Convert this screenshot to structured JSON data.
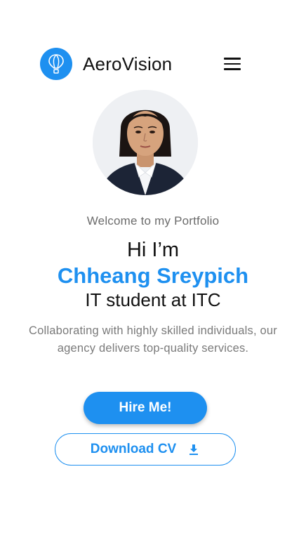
{
  "header": {
    "brand": "AeroVision",
    "logo_icon": "hot-air-balloon-icon",
    "menu_icon": "hamburger-menu-icon",
    "accent_color": "#1e90f0"
  },
  "hero": {
    "welcome": "Welcome to my Portfolio",
    "greeting": "Hi I’m",
    "name": "Chheang Sreypich",
    "role": "IT student at ITC",
    "description": "Collaborating with highly skilled individuals, our agency delivers top-quality services."
  },
  "actions": {
    "hire_label": "Hire Me!",
    "download_label": "Download CV",
    "download_icon": "download-icon"
  }
}
